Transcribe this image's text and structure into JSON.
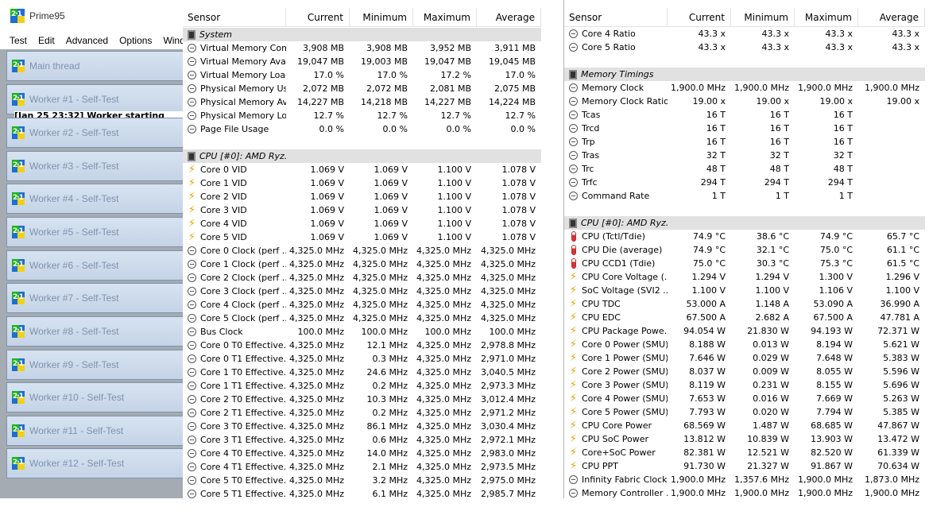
{
  "prime95": {
    "title": "Prime95",
    "menu": [
      "Test",
      "Edit",
      "Advanced",
      "Options",
      "Wind"
    ],
    "workers": [
      "Main thread",
      "Worker #1 - Self-Test",
      "Worker #2 - Self-Test",
      "Worker #3 - Self-Test",
      "Worker #4 - Self-Test",
      "Worker #5 - Self-Test",
      "Worker #6 - Self-Test",
      "Worker #7 - Self-Test",
      "Worker #8 - Self-Test",
      "Worker #9 - Self-Test",
      "Worker #10 - Self-Test",
      "Worker #11 - Self-Test",
      "Worker #12 - Self-Test"
    ],
    "worker_log": "[Jan 25 23:32] Worker starting"
  },
  "left_table": {
    "headers": [
      "Sensor",
      "Current",
      "Minimum",
      "Maximum",
      "Average"
    ],
    "rows": [
      {
        "type": "group",
        "icon": "chip",
        "name": "System"
      },
      {
        "icon": "circle",
        "name": "Virtual Memory Com...",
        "v": [
          "3,908 MB",
          "3,908 MB",
          "3,952 MB",
          "3,911 MB"
        ]
      },
      {
        "icon": "circle",
        "name": "Virtual Memory Avai...",
        "v": [
          "19,047 MB",
          "19,003 MB",
          "19,047 MB",
          "19,045 MB"
        ]
      },
      {
        "icon": "circle",
        "name": "Virtual Memory Load",
        "v": [
          "17.0 %",
          "17.0 %",
          "17.2 %",
          "17.0 %"
        ]
      },
      {
        "icon": "circle",
        "name": "Physical Memory Used",
        "v": [
          "2,072 MB",
          "2,072 MB",
          "2,081 MB",
          "2,075 MB"
        ]
      },
      {
        "icon": "circle",
        "name": "Physical Memory Av...",
        "v": [
          "14,227 MB",
          "14,218 MB",
          "14,227 MB",
          "14,224 MB"
        ]
      },
      {
        "icon": "circle",
        "name": "Physical Memory Load",
        "v": [
          "12.7 %",
          "12.7 %",
          "12.7 %",
          "12.7 %"
        ]
      },
      {
        "icon": "circle",
        "name": "Page File Usage",
        "v": [
          "0.0 %",
          "0.0 %",
          "0.0 %",
          "0.0 %"
        ]
      },
      {
        "type": "blank"
      },
      {
        "type": "group",
        "icon": "chip",
        "name": "CPU [#0]: AMD Ryz..."
      },
      {
        "icon": "bolt",
        "name": "Core 0 VID",
        "v": [
          "1.069 V",
          "1.069 V",
          "1.100 V",
          "1.078 V"
        ]
      },
      {
        "icon": "bolt",
        "name": "Core 1 VID",
        "v": [
          "1.069 V",
          "1.069 V",
          "1.100 V",
          "1.078 V"
        ]
      },
      {
        "icon": "bolt",
        "name": "Core 2 VID",
        "v": [
          "1.069 V",
          "1.069 V",
          "1.100 V",
          "1.078 V"
        ]
      },
      {
        "icon": "bolt",
        "name": "Core 3 VID",
        "v": [
          "1.069 V",
          "1.069 V",
          "1.100 V",
          "1.078 V"
        ]
      },
      {
        "icon": "bolt",
        "name": "Core 4 VID",
        "v": [
          "1.069 V",
          "1.069 V",
          "1.100 V",
          "1.078 V"
        ]
      },
      {
        "icon": "bolt",
        "name": "Core 5 VID",
        "v": [
          "1.069 V",
          "1.069 V",
          "1.100 V",
          "1.078 V"
        ]
      },
      {
        "icon": "circle",
        "name": "Core 0 Clock (perf ...",
        "v": [
          "4,325.0 MHz",
          "4,325.0 MHz",
          "4,325.0 MHz",
          "4,325.0 MHz"
        ]
      },
      {
        "icon": "circle",
        "name": "Core 1 Clock (perf ...",
        "v": [
          "4,325.0 MHz",
          "4,325.0 MHz",
          "4,325.0 MHz",
          "4,325.0 MHz"
        ]
      },
      {
        "icon": "circle",
        "name": "Core 2 Clock (perf ...",
        "v": [
          "4,325.0 MHz",
          "4,325.0 MHz",
          "4,325.0 MHz",
          "4,325.0 MHz"
        ]
      },
      {
        "icon": "circle",
        "name": "Core 3 Clock (perf ...",
        "v": [
          "4,325.0 MHz",
          "4,325.0 MHz",
          "4,325.0 MHz",
          "4,325.0 MHz"
        ]
      },
      {
        "icon": "circle",
        "name": "Core 4 Clock (perf ...",
        "v": [
          "4,325.0 MHz",
          "4,325.0 MHz",
          "4,325.0 MHz",
          "4,325.0 MHz"
        ]
      },
      {
        "icon": "circle",
        "name": "Core 5 Clock (perf ...",
        "v": [
          "4,325.0 MHz",
          "4,325.0 MHz",
          "4,325.0 MHz",
          "4,325.0 MHz"
        ]
      },
      {
        "icon": "circle",
        "name": "Bus Clock",
        "v": [
          "100.0 MHz",
          "100.0 MHz",
          "100.0 MHz",
          "100.0 MHz"
        ]
      },
      {
        "icon": "circle",
        "name": "Core 0 T0 Effective...",
        "v": [
          "4,325.0 MHz",
          "12.1 MHz",
          "4,325.0 MHz",
          "2,978.8 MHz"
        ]
      },
      {
        "icon": "circle",
        "name": "Core 0 T1 Effective...",
        "v": [
          "4,325.0 MHz",
          "0.3 MHz",
          "4,325.0 MHz",
          "2,971.0 MHz"
        ]
      },
      {
        "icon": "circle",
        "name": "Core 1 T0 Effective...",
        "v": [
          "4,325.0 MHz",
          "24.6 MHz",
          "4,325.0 MHz",
          "3,040.5 MHz"
        ]
      },
      {
        "icon": "circle",
        "name": "Core 1 T1 Effective...",
        "v": [
          "4,325.0 MHz",
          "0.2 MHz",
          "4,325.0 MHz",
          "2,973.3 MHz"
        ]
      },
      {
        "icon": "circle",
        "name": "Core 2 T0 Effective...",
        "v": [
          "4,325.0 MHz",
          "10.3 MHz",
          "4,325.0 MHz",
          "3,012.4 MHz"
        ]
      },
      {
        "icon": "circle",
        "name": "Core 2 T1 Effective...",
        "v": [
          "4,325.0 MHz",
          "0.2 MHz",
          "4,325.0 MHz",
          "2,971.2 MHz"
        ]
      },
      {
        "icon": "circle",
        "name": "Core 3 T0 Effective...",
        "v": [
          "4,325.0 MHz",
          "86.1 MHz",
          "4,325.0 MHz",
          "3,030.4 MHz"
        ]
      },
      {
        "icon": "circle",
        "name": "Core 3 T1 Effective...",
        "v": [
          "4,325.0 MHz",
          "0.6 MHz",
          "4,325.0 MHz",
          "2,972.1 MHz"
        ]
      },
      {
        "icon": "circle",
        "name": "Core 4 T0 Effective...",
        "v": [
          "4,325.0 MHz",
          "14.0 MHz",
          "4,325.0 MHz",
          "2,983.0 MHz"
        ]
      },
      {
        "icon": "circle",
        "name": "Core 4 T1 Effective...",
        "v": [
          "4,325.0 MHz",
          "2.1 MHz",
          "4,325.0 MHz",
          "2,973.5 MHz"
        ]
      },
      {
        "icon": "circle",
        "name": "Core 5 T0 Effective...",
        "v": [
          "4,325.0 MHz",
          "3.2 MHz",
          "4,325.0 MHz",
          "2,975.0 MHz"
        ]
      },
      {
        "icon": "circle",
        "name": "Core 5 T1 Effective...",
        "v": [
          "4,325.0 MHz",
          "6.1 MHz",
          "4,325.0 MHz",
          "2,985.7 MHz"
        ]
      }
    ]
  },
  "right_table": {
    "headers": [
      "Sensor",
      "Current",
      "Minimum",
      "Maximum",
      "Average"
    ],
    "rows": [
      {
        "icon": "circle",
        "name": "Core 4 Ratio",
        "v": [
          "43.3 x",
          "43.3 x",
          "43.3 x",
          "43.3 x"
        ]
      },
      {
        "icon": "circle",
        "name": "Core 5 Ratio",
        "v": [
          "43.3 x",
          "43.3 x",
          "43.3 x",
          "43.3 x"
        ]
      },
      {
        "type": "blank"
      },
      {
        "type": "group",
        "icon": "chip",
        "name": "Memory Timings"
      },
      {
        "icon": "circle",
        "name": "Memory Clock",
        "v": [
          "1,900.0 MHz",
          "1,900.0 MHz",
          "1,900.0 MHz",
          "1,900.0 MHz"
        ]
      },
      {
        "icon": "circle",
        "name": "Memory Clock Ratio",
        "v": [
          "19.00 x",
          "19.00 x",
          "19.00 x",
          "19.00 x"
        ]
      },
      {
        "icon": "circle",
        "name": "Tcas",
        "v": [
          "16 T",
          "16 T",
          "16 T",
          ""
        ]
      },
      {
        "icon": "circle",
        "name": "Trcd",
        "v": [
          "16 T",
          "16 T",
          "16 T",
          ""
        ]
      },
      {
        "icon": "circle",
        "name": "Trp",
        "v": [
          "16 T",
          "16 T",
          "16 T",
          ""
        ]
      },
      {
        "icon": "circle",
        "name": "Tras",
        "v": [
          "32 T",
          "32 T",
          "32 T",
          ""
        ]
      },
      {
        "icon": "circle",
        "name": "Trc",
        "v": [
          "48 T",
          "48 T",
          "48 T",
          ""
        ]
      },
      {
        "icon": "circle",
        "name": "Trfc",
        "v": [
          "294 T",
          "294 T",
          "294 T",
          ""
        ]
      },
      {
        "icon": "circle",
        "name": "Command Rate",
        "v": [
          "1 T",
          "1 T",
          "1 T",
          ""
        ]
      },
      {
        "type": "blank"
      },
      {
        "type": "group",
        "icon": "chip",
        "name": "CPU [#0]: AMD Ryz..."
      },
      {
        "icon": "therm",
        "name": "CPU (Tctl/Tdie)",
        "v": [
          "74.9 °C",
          "38.6 °C",
          "74.9 °C",
          "65.7 °C"
        ]
      },
      {
        "icon": "therm",
        "name": "CPU Die (average)",
        "v": [
          "74.9 °C",
          "32.1 °C",
          "75.0 °C",
          "61.1 °C"
        ]
      },
      {
        "icon": "therm",
        "name": "CPU CCD1 (Tdie)",
        "v": [
          "75.0 °C",
          "30.3 °C",
          "75.3 °C",
          "61.5 °C"
        ]
      },
      {
        "icon": "bolt",
        "name": "CPU Core Voltage (...",
        "v": [
          "1.294 V",
          "1.294 V",
          "1.300 V",
          "1.296 V"
        ]
      },
      {
        "icon": "bolt",
        "name": "SoC Voltage (SVI2 ...",
        "v": [
          "1.100 V",
          "1.100 V",
          "1.106 V",
          "1.100 V"
        ]
      },
      {
        "icon": "bolt",
        "name": "CPU TDC",
        "v": [
          "53.000 A",
          "1.148 A",
          "53.090 A",
          "36.990 A"
        ]
      },
      {
        "icon": "bolt",
        "name": "CPU EDC",
        "v": [
          "67.500 A",
          "2.682 A",
          "67.500 A",
          "47.781 A"
        ]
      },
      {
        "icon": "bolt",
        "name": "CPU Package Powe...",
        "v": [
          "94.054 W",
          "21.830 W",
          "94.193 W",
          "72.371 W"
        ]
      },
      {
        "icon": "bolt",
        "name": "Core 0 Power (SMU)",
        "v": [
          "8.188 W",
          "0.013 W",
          "8.194 W",
          "5.621 W"
        ]
      },
      {
        "icon": "bolt",
        "name": "Core 1 Power (SMU)",
        "v": [
          "7.646 W",
          "0.029 W",
          "7.648 W",
          "5.383 W"
        ]
      },
      {
        "icon": "bolt",
        "name": "Core 2 Power (SMU)",
        "v": [
          "8.037 W",
          "0.009 W",
          "8.055 W",
          "5.596 W"
        ]
      },
      {
        "icon": "bolt",
        "name": "Core 3 Power (SMU)",
        "v": [
          "8.119 W",
          "0.231 W",
          "8.155 W",
          "5.696 W"
        ]
      },
      {
        "icon": "bolt",
        "name": "Core 4 Power (SMU)",
        "v": [
          "7.653 W",
          "0.016 W",
          "7.669 W",
          "5.263 W"
        ]
      },
      {
        "icon": "bolt",
        "name": "Core 5 Power (SMU)",
        "v": [
          "7.793 W",
          "0.020 W",
          "7.794 W",
          "5.385 W"
        ]
      },
      {
        "icon": "bolt",
        "name": "CPU Core Power",
        "v": [
          "68.569 W",
          "1.487 W",
          "68.685 W",
          "47.867 W"
        ]
      },
      {
        "icon": "bolt",
        "name": "CPU SoC Power",
        "v": [
          "13.812 W",
          "10.839 W",
          "13.903 W",
          "13.472 W"
        ]
      },
      {
        "icon": "bolt",
        "name": "Core+SoC Power",
        "v": [
          "82.381 W",
          "12.521 W",
          "82.520 W",
          "61.339 W"
        ]
      },
      {
        "icon": "bolt",
        "name": "CPU PPT",
        "v": [
          "91.730 W",
          "21.327 W",
          "91.867 W",
          "70.634 W"
        ]
      },
      {
        "icon": "circle",
        "name": "Infinity Fabric Clock...",
        "v": [
          "1,900.0 MHz",
          "1,357.6 MHz",
          "1,900.0 MHz",
          "1,873.0 MHz"
        ]
      },
      {
        "icon": "circle",
        "name": "Memory Controller ...",
        "v": [
          "1,900.0 MHz",
          "1,900.0 MHz",
          "1,900.0 MHz",
          "1,900.0 MHz"
        ]
      }
    ]
  }
}
